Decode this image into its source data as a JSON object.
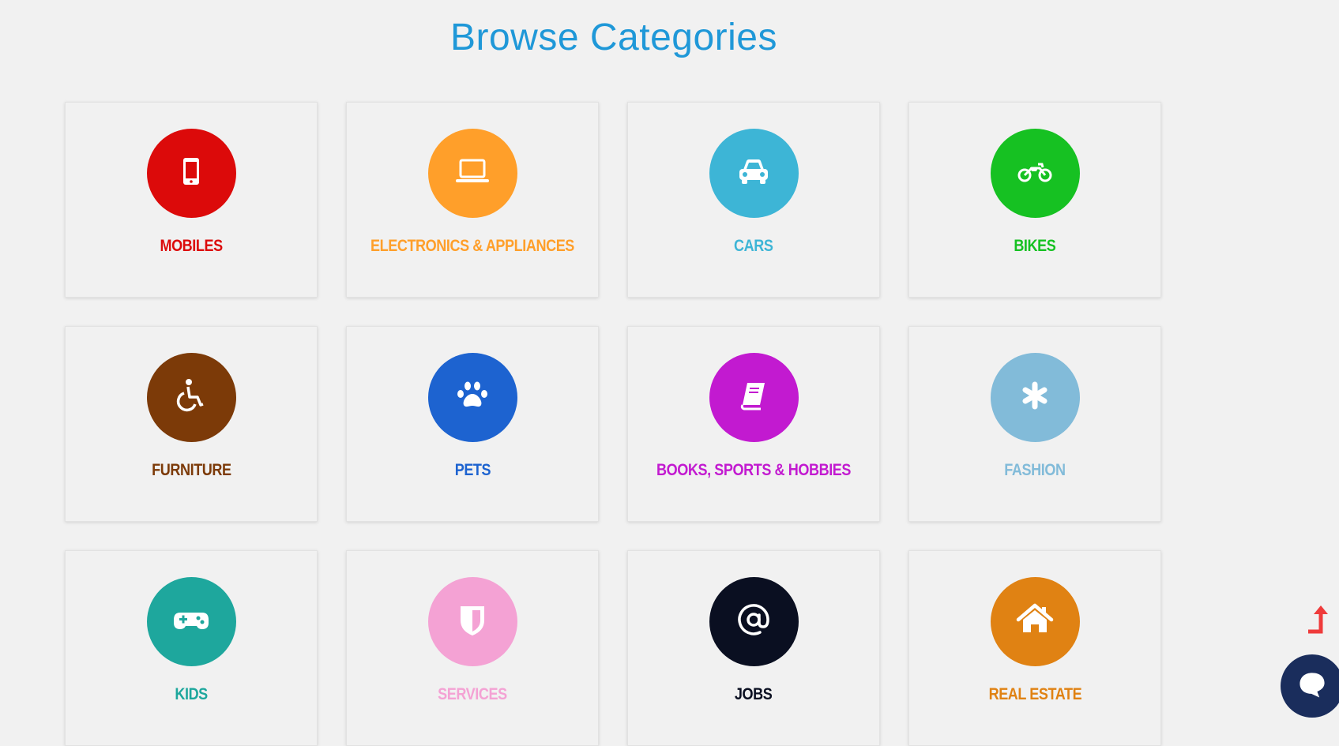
{
  "page": {
    "title": "Browse Categories"
  },
  "categories": [
    {
      "label": "MOBILES",
      "color": "#dc0a0a",
      "icon": "mobile-phone-icon"
    },
    {
      "label": "ELECTRONICS & APPLIANCES",
      "color": "#ff9f2a",
      "icon": "laptop-icon"
    },
    {
      "label": "CARS",
      "color": "#3db5d6",
      "icon": "car-icon"
    },
    {
      "label": "BIKES",
      "color": "#16c122",
      "icon": "motorcycle-icon"
    },
    {
      "label": "FURNITURE",
      "color": "#7c3a08",
      "icon": "wheelchair-icon"
    },
    {
      "label": "PETS",
      "color": "#1d63d0",
      "icon": "paw-icon"
    },
    {
      "label": "BOOKS, SPORTS & HOBBIES",
      "color": "#c21ad0",
      "icon": "book-icon"
    },
    {
      "label": "FASHION",
      "color": "#82bbd9",
      "icon": "asterisk-icon"
    },
    {
      "label": "KIDS",
      "color": "#1ea79d",
      "icon": "gamepad-icon"
    },
    {
      "label": "SERVICES",
      "color": "#f4a2d4",
      "icon": "shield-icon"
    },
    {
      "label": "JOBS",
      "color": "#0a0f21",
      "icon": "at-sign-icon"
    },
    {
      "label": "REAL ESTATE",
      "color": "#e08213",
      "icon": "house-icon"
    }
  ],
  "widgets": {
    "scroll_top_color": "#ef3b3b",
    "chat_color": "#1a2d5c"
  }
}
